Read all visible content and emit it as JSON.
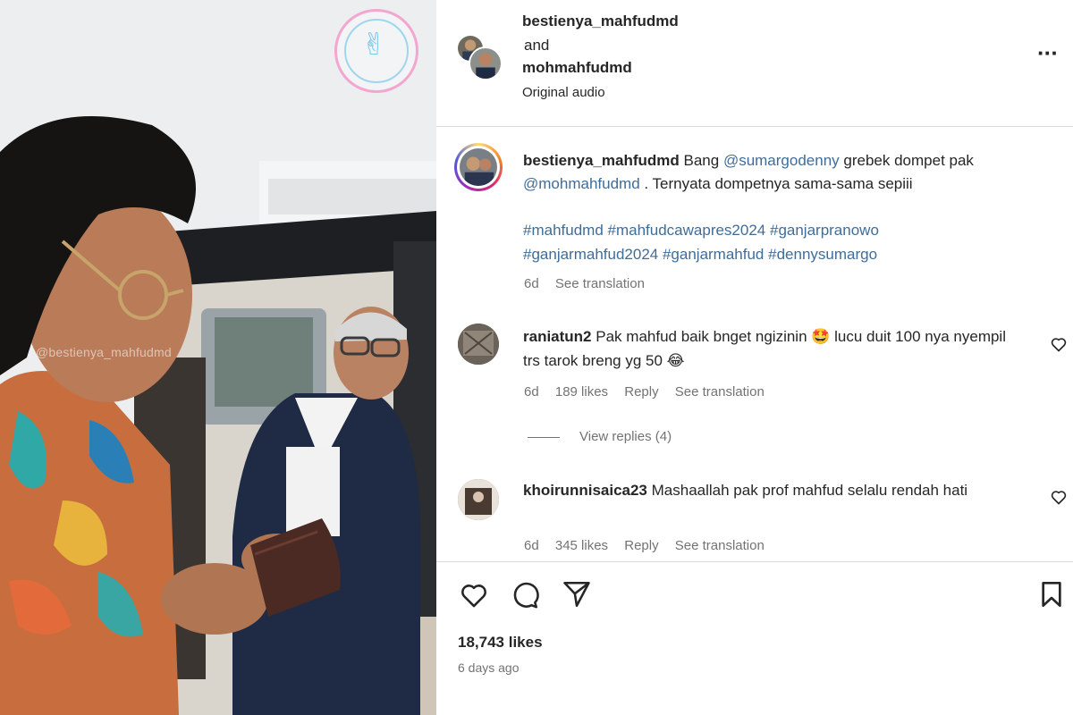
{
  "media": {
    "watermark": "@bestienya_mahfudmd",
    "logo_icon": "three-fingers-hand-icon"
  },
  "header": {
    "user1": "bestienya_mahfudmd",
    "conjunction": "and",
    "user2": "mohmahfudmd",
    "audio": "Original audio"
  },
  "caption": {
    "username": "bestienya_mahfudmd",
    "text_1": "Bang",
    "mention_1": "@sumargodenny",
    "text_2": "grebek dompet pak",
    "mention_2": "@mohmahfudmd",
    "text_3": ". Ternyata dompetnya sama-sama sepiii",
    "hashtags": [
      "#mahfudmd",
      "#mahfudcawapres2024",
      "#ganjarpranowo",
      "#ganjarmahfud2024",
      "#ganjarmahfud",
      "#dennysumargo"
    ],
    "age": "6d",
    "see_translation": "See translation"
  },
  "comments": [
    {
      "username": "raniatun2",
      "text": "Pak mahfud baik bnget ngizinin 🤩 lucu duit 100 nya nyempil trs tarok breng yg 50 😂",
      "age": "6d",
      "likes": "189 likes",
      "reply": "Reply",
      "see_translation": "See translation",
      "view_replies": "View replies (4)"
    },
    {
      "username": "khoirunnisaica23",
      "text": "Mashaallah pak prof mahfud selalu rendah hati",
      "age": "6d",
      "likes": "345 likes",
      "reply": "Reply",
      "see_translation": "See translation"
    }
  ],
  "footer": {
    "likes": "18,743 likes",
    "date": "6 days ago"
  },
  "colors": {
    "link": "#3f6d9a",
    "muted": "#737373",
    "divider": "#dbdbdb"
  }
}
